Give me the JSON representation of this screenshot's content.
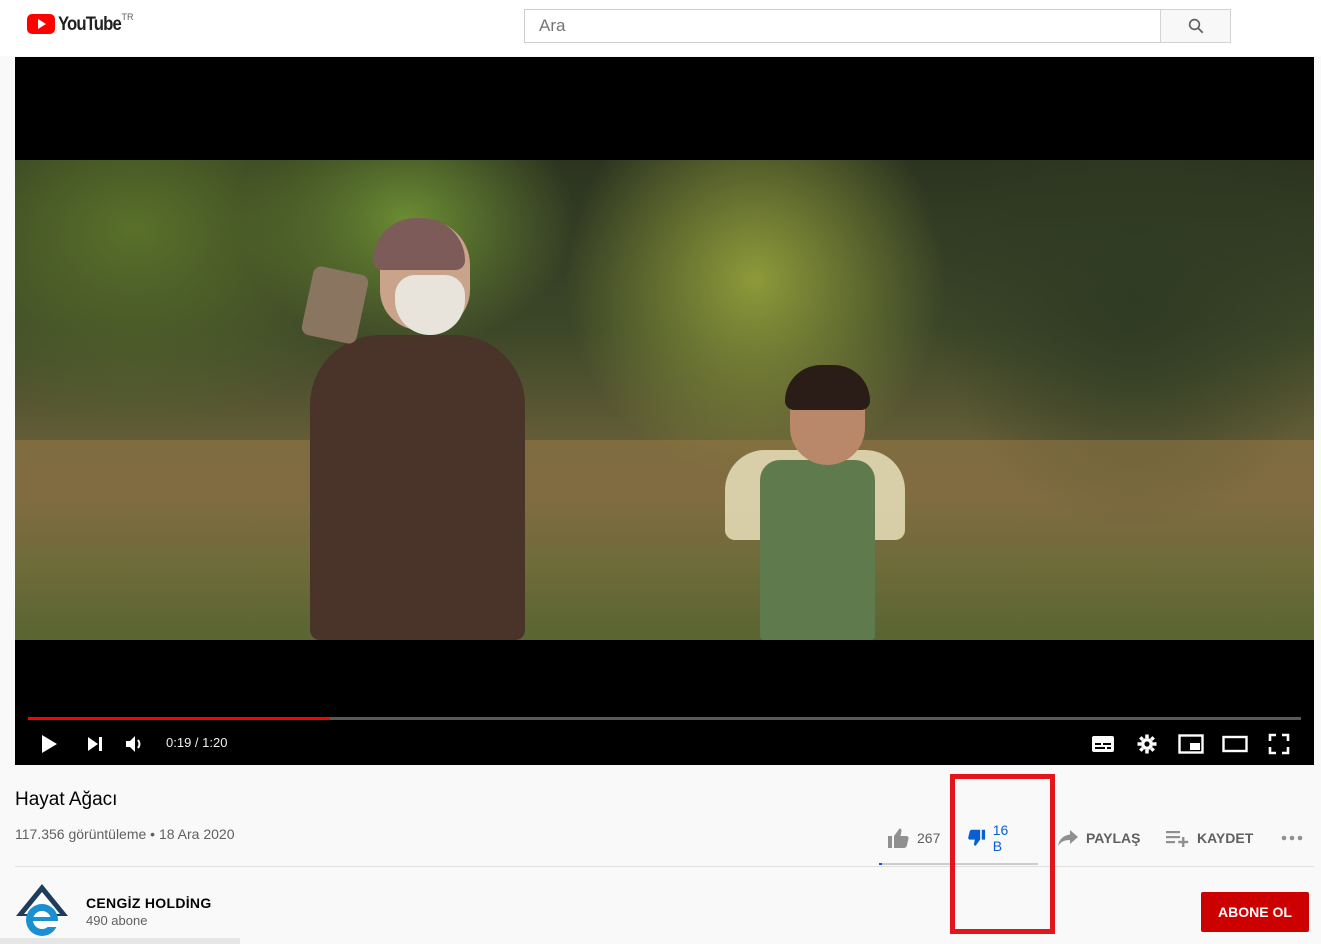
{
  "header": {
    "logo_text": "YouTube",
    "country_code": "TR",
    "search_placeholder": "Ara"
  },
  "player": {
    "time_display": "0:19 / 1:20",
    "progress_fraction": 0.2375
  },
  "video": {
    "title": "Hayat Ağacı",
    "views_date": "117.356 görüntüleme • 18 Ara 2020",
    "like_count": "267",
    "dislike_count": "16 B",
    "share_label": "PAYLAŞ",
    "save_label": "KAYDET",
    "like_ratio": 0.0164
  },
  "channel": {
    "name": "CENGİZ HOLDİNG",
    "subscribers": "490 abone",
    "subscribe_label": "ABONE OL"
  },
  "colors": {
    "brand_red": "#ff0000",
    "subscribe_red": "#cc0000",
    "active_blue": "#065fd4",
    "highlight_red": "#e3141b"
  }
}
